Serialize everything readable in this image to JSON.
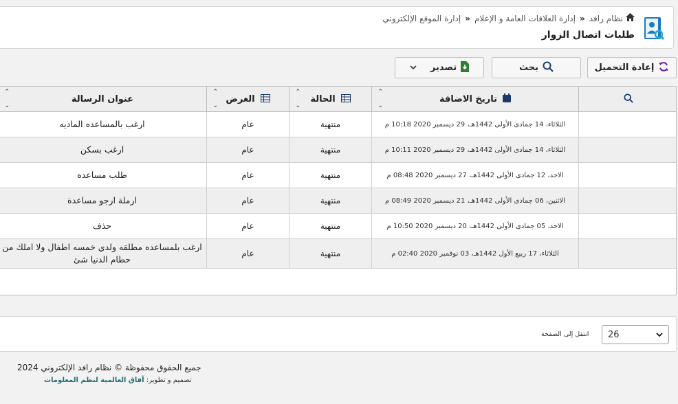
{
  "breadcrumb": {
    "home": "نظام رافد",
    "level1": "إدارة العلاقات العامة و الإعلام",
    "level2": "إدارة الموقع الإلكتروني"
  },
  "page_title": "طلبات اتصال الزوار",
  "toolbar": {
    "reload_label": "إعادة التحميل",
    "search_label": "بحث",
    "export_label": "تصدير"
  },
  "table": {
    "columns": {
      "date": "تاريخ الاضافة",
      "status": "الحالة",
      "purpose": "الغرض",
      "subject": "عنوان الرسالة"
    },
    "rows": [
      {
        "date": "الثلاثاء، 14 جمادى الأولى 1442هـ، 29 ديسمبر 2020 10:18 م",
        "status": "منتهية",
        "purpose": "عام",
        "subject": "ارغب بالمساعده الماديه"
      },
      {
        "date": "الثلاثاء، 14 جمادى الأولى 1442هـ، 29 ديسمبر 2020 10:11 م",
        "status": "منتهية",
        "purpose": "عام",
        "subject": "ارغب بسكن"
      },
      {
        "date": "الاحد، 12 جمادى الأولى 1442هـ، 27 ديسمبر 2020 08:48 م",
        "status": "منتهية",
        "purpose": "عام",
        "subject": "طلب مساعده"
      },
      {
        "date": "الاثنين، 06 جمادى الأولى 1442هـ، 21 ديسمبر 2020 08:49 م",
        "status": "منتهية",
        "purpose": "عام",
        "subject": "ارملة ارجو مساعدة"
      },
      {
        "date": "الاحد، 05 جمادى الأولى 1442هـ، 20 ديسمبر 2020 10:50 م",
        "status": "منتهية",
        "purpose": "عام",
        "subject": "حذف"
      },
      {
        "date": "الثلاثاء، 17 ربيع الأول 1442هـ، 03 نوفمبر 2020 02:40 م",
        "status": "منتهية",
        "purpose": "عام",
        "subject": "ارغب بلمساعده مطلقه ولدي خمسه اطفال ولا املك من حطام الدنيا شئ"
      }
    ]
  },
  "pager": {
    "page_value": "26",
    "go_to_label": "انتقل إلى الصفحة"
  },
  "footer": {
    "copyright": "جميع الحقوق محفوظة © نظام رافد الإلكتروني 2024",
    "credit_prefix": "تصميم و تطوير:",
    "credit_brand": "آفاق العالمية لنظم المعلومات"
  },
  "colors": {
    "accent": "#1b7bbf",
    "export_icon": "#2e7d32",
    "reload_icon": "#6a1b9a",
    "footer_brand": "#1f6f78"
  }
}
